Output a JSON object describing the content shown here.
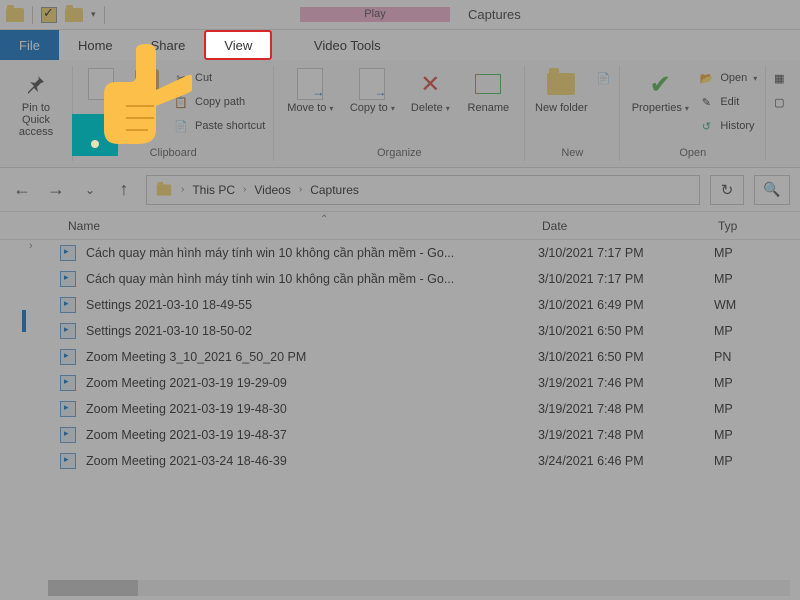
{
  "title": "Captures",
  "contextual_tab_group": "Play",
  "tabs": {
    "file": "File",
    "home": "Home",
    "share": "Share",
    "view": "View",
    "video_tools": "Video Tools"
  },
  "ribbon": {
    "pin_to_quick_label": "Pin to Quick access",
    "clipboard": {
      "cut": "Cut",
      "copy_path": "Copy path",
      "paste_shortcut": "Paste shortcut",
      "group_label": "Clipboard"
    },
    "organize": {
      "move_to": "Move to",
      "copy_to": "Copy to",
      "delete": "Delete",
      "rename": "Rename",
      "group_label": "Organize"
    },
    "new": {
      "new_folder": "New folder",
      "group_label": "New"
    },
    "open": {
      "properties": "Properties",
      "open": "Open",
      "edit": "Edit",
      "history": "History",
      "group_label": "Open"
    }
  },
  "breadcrumbs": [
    "This PC",
    "Videos",
    "Captures"
  ],
  "columns": {
    "name": "Name",
    "date": "Date",
    "type": "Typ"
  },
  "files": [
    {
      "name": "Cách quay màn hình máy tính win 10 không cần phần mềm - Go...",
      "date": "3/10/2021 7:17 PM",
      "type": "MP"
    },
    {
      "name": "Cách quay màn hình máy tính win 10 không cần phần mềm - Go...",
      "date": "3/10/2021 7:17 PM",
      "type": "MP"
    },
    {
      "name": "Settings 2021-03-10 18-49-55",
      "date": "3/10/2021 6:49 PM",
      "type": "WM"
    },
    {
      "name": "Settings 2021-03-10 18-50-02",
      "date": "3/10/2021 6:50 PM",
      "type": "MP"
    },
    {
      "name": "Zoom Meeting 3_10_2021 6_50_20 PM",
      "date": "3/10/2021 6:50 PM",
      "type": "PN"
    },
    {
      "name": "Zoom Meeting 2021-03-19 19-29-09",
      "date": "3/19/2021 7:46 PM",
      "type": "MP"
    },
    {
      "name": "Zoom Meeting 2021-03-19 19-48-30",
      "date": "3/19/2021 7:48 PM",
      "type": "MP"
    },
    {
      "name": "Zoom Meeting 2021-03-19 19-48-37",
      "date": "3/19/2021 7:48 PM",
      "type": "MP"
    },
    {
      "name": "Zoom Meeting 2021-03-24 18-46-39",
      "date": "3/24/2021 6:46 PM",
      "type": "MP"
    }
  ],
  "dropdown_caret": "▾"
}
